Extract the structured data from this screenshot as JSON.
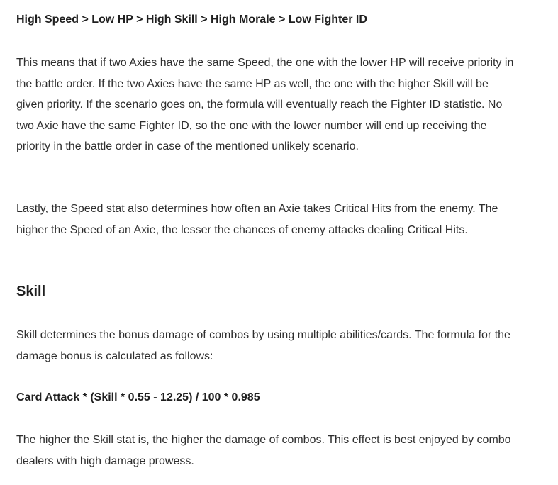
{
  "article": {
    "priority_formula": "High Speed > Low HP > High Skill > High Morale > Low Fighter ID",
    "para_priority_explanation": "This means that if two Axies have the same Speed, the one with the lower HP will receive priority in the battle order. If the two Axies have the same HP as well, the one with the higher Skill will be given priority. If the scenario goes on, the formula will eventually reach the Fighter ID statistic. No two Axie have the same Fighter ID, so the one with the lower number will end up receiving the priority in the battle order in case of the mentioned unlikely scenario.",
    "para_critical_hits": "Lastly, the Speed stat also determines how often an Axie takes Critical Hits from the enemy. The higher the Speed of an Axie, the lesser the chances of enemy attacks dealing Critical Hits.",
    "skill_heading": "Skill",
    "para_skill_intro": "Skill determines the bonus damage of combos by using multiple abilities/cards. The formula for the damage bonus is calculated as follows:",
    "damage_formula": "Card Attack * (Skill * 0.55 - 12.25) / 100 * 0.985",
    "para_skill_effect": "The higher the Skill stat is, the higher the damage of combos. This effect is best enjoyed by combo dealers with high damage prowess."
  }
}
